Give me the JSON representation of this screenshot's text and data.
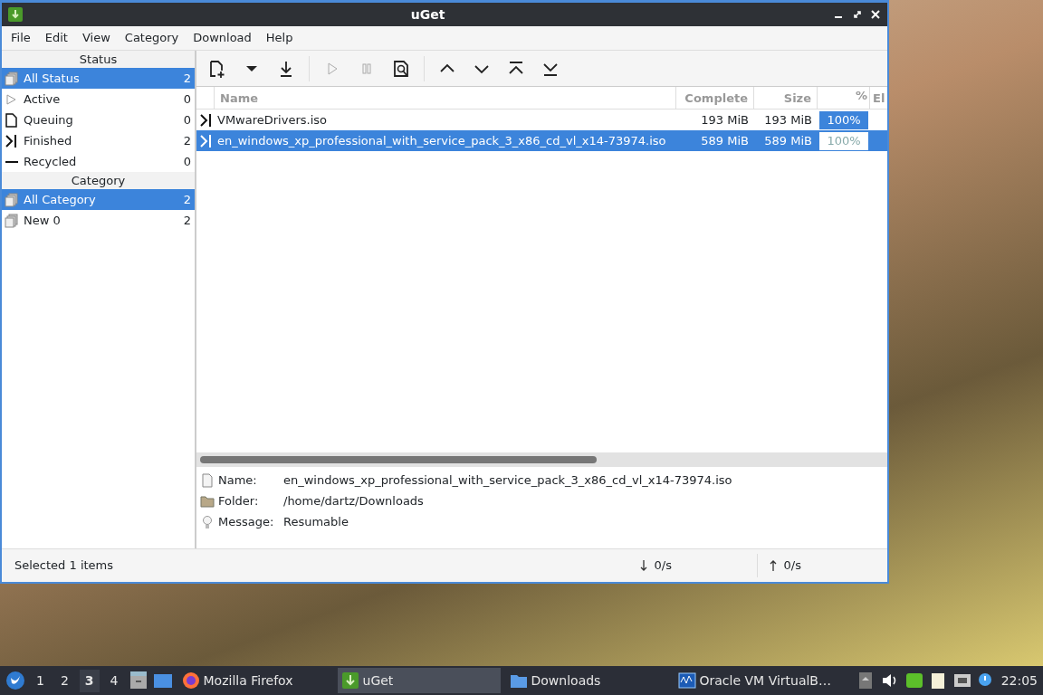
{
  "window": {
    "title": "uGet"
  },
  "menu": [
    "File",
    "Edit",
    "View",
    "Category",
    "Download",
    "Help"
  ],
  "sidebar": {
    "status_title": "Status",
    "status_items": [
      {
        "label": "All Status",
        "count": "2",
        "selected": true,
        "kind": "all"
      },
      {
        "label": "Active",
        "count": "0",
        "selected": false,
        "kind": "active"
      },
      {
        "label": "Queuing",
        "count": "0",
        "selected": false,
        "kind": "queuing"
      },
      {
        "label": "Finished",
        "count": "2",
        "selected": false,
        "kind": "finished"
      },
      {
        "label": "Recycled",
        "count": "0",
        "selected": false,
        "kind": "recycled"
      }
    ],
    "category_title": "Category",
    "category_items": [
      {
        "label": "All Category",
        "count": "2",
        "selected": true,
        "kind": "all"
      },
      {
        "label": "New 0",
        "count": "2",
        "selected": false,
        "kind": "all"
      }
    ]
  },
  "toolbar": [
    {
      "kind": "new",
      "disabled": false
    },
    {
      "kind": "dropdown",
      "disabled": false
    },
    {
      "kind": "download",
      "disabled": false
    },
    {
      "kind": "sep"
    },
    {
      "kind": "play",
      "disabled": true
    },
    {
      "kind": "pause",
      "disabled": true
    },
    {
      "kind": "properties",
      "disabled": false
    },
    {
      "kind": "sep"
    },
    {
      "kind": "up",
      "disabled": false
    },
    {
      "kind": "down",
      "disabled": false
    },
    {
      "kind": "top",
      "disabled": false
    },
    {
      "kind": "bottom",
      "disabled": false
    }
  ],
  "table": {
    "columns": [
      "Name",
      "Complete",
      "Size",
      "%",
      "El"
    ],
    "rows": [
      {
        "name": "VMwareDrivers.iso",
        "complete": "193 MiB",
        "size": "193 MiB",
        "percent": "100%",
        "level": 1,
        "selected": false
      },
      {
        "name": "en_windows_xp_professional_with_service_pack_3_x86_cd_vl_x14-73974.iso",
        "complete": "589 MiB",
        "size": "589 MiB",
        "percent": "100%",
        "level": 1,
        "selected": true
      }
    ]
  },
  "details": [
    {
      "kind": "file",
      "label": "Name:",
      "value": "en_windows_xp_professional_with_service_pack_3_x86_cd_vl_x14-73974.iso"
    },
    {
      "kind": "folder",
      "label": "Folder:",
      "value": "/home/dartz/Downloads"
    },
    {
      "kind": "message",
      "label": "Message:",
      "value": "Resumable"
    }
  ],
  "status_bar": {
    "text": "Selected 1 items",
    "download_speed": "0/s",
    "upload_speed": "0/s"
  },
  "taskbar": {
    "workspaces": [
      {
        "label": "1",
        "selected": false
      },
      {
        "label": "2",
        "selected": false
      },
      {
        "label": "3",
        "selected": true
      },
      {
        "label": "4",
        "selected": false
      }
    ],
    "tasks": [
      {
        "kind": "firefox",
        "label": "Mozilla Firefox",
        "selected": false
      },
      {
        "kind": "uget",
        "label": "uGet",
        "selected": true
      },
      {
        "kind": "folder",
        "label": "Downloads",
        "selected": false
      },
      {
        "kind": "vbox",
        "label": "Oracle VM VirtualB…",
        "selected": false
      }
    ],
    "clock": "22:05"
  }
}
